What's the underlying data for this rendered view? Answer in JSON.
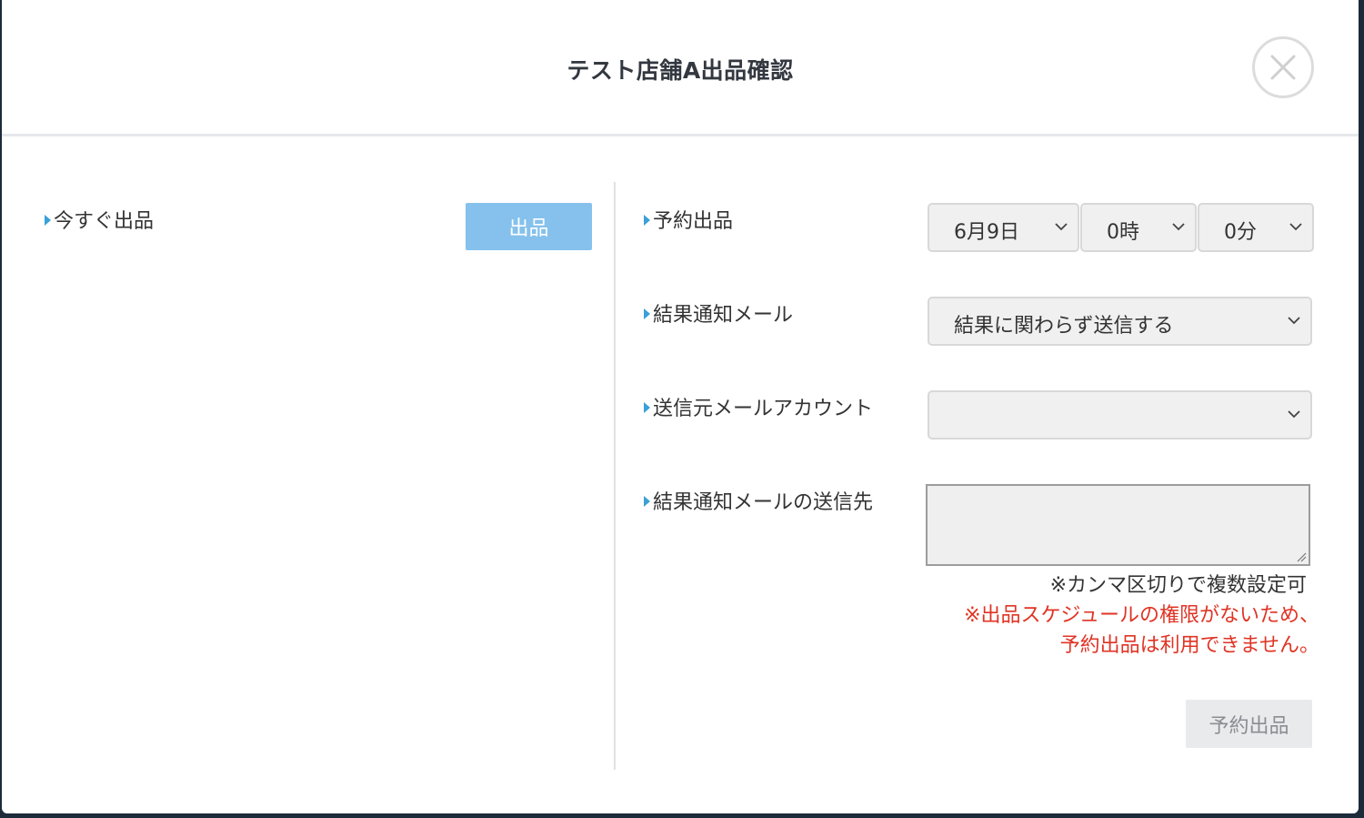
{
  "modal": {
    "title": "テスト店舗A出品確認",
    "close_icon": "close-icon"
  },
  "left": {
    "now_label": "今すぐ出品",
    "now_button": "出品"
  },
  "right": {
    "reserve_label": "予約出品",
    "date_select": "6月9日",
    "hour_select": "0時",
    "minute_select": "0分",
    "notify_label": "結果通知メール",
    "notify_select": "結果に関わらず送信する",
    "sender_label": "送信元メールアカウント",
    "sender_select": "",
    "recipient_label": "結果通知メールの送信先",
    "recipient_value": "",
    "comma_note": "※カンマ区切りで複数設定可",
    "warning_line1": "※出品スケジュールの権限がないため、",
    "warning_line2": "予約出品は利用できません。",
    "reserve_button": "予約出品"
  },
  "colors": {
    "primary_button": "#85c1ec",
    "warning_text": "#e03424",
    "disabled_button": "#e9eaec",
    "label_marker": "#3aa0d8"
  }
}
